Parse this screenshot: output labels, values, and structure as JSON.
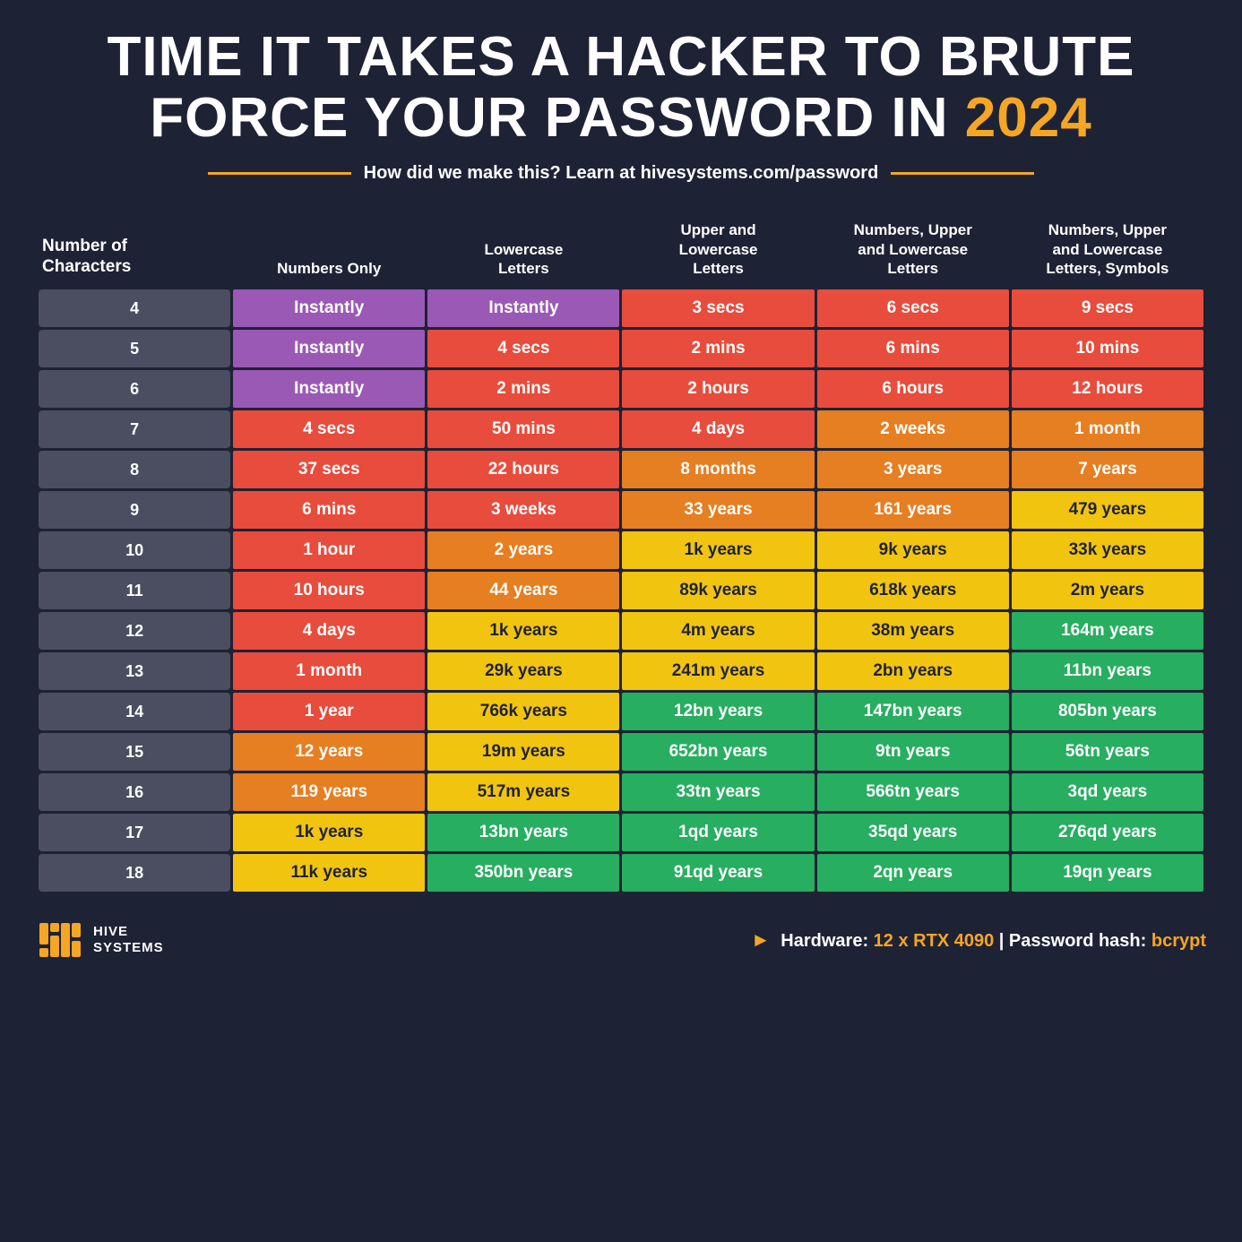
{
  "title": {
    "line1": "TIME IT TAKES A HACKER TO BRUTE",
    "line2": "FORCE YOUR PASSWORD IN",
    "year": "2024"
  },
  "subtitle": "How did we make this? Learn at hivesystems.com/password",
  "columns": [
    "Number of Characters",
    "Numbers Only",
    "Lowercase Letters",
    "Upper and Lowercase Letters",
    "Numbers, Upper and Lowercase Letters",
    "Numbers, Upper and Lowercase Letters, Symbols"
  ],
  "rows": [
    {
      "chars": "4",
      "values": [
        "Instantly",
        "Instantly",
        "3 secs",
        "6 secs",
        "9 secs"
      ],
      "colors": [
        "purple",
        "purple",
        "red",
        "red",
        "red"
      ]
    },
    {
      "chars": "5",
      "values": [
        "Instantly",
        "4 secs",
        "2 mins",
        "6 mins",
        "10 mins"
      ],
      "colors": [
        "purple",
        "red",
        "red",
        "red",
        "red"
      ]
    },
    {
      "chars": "6",
      "values": [
        "Instantly",
        "2 mins",
        "2 hours",
        "6 hours",
        "12 hours"
      ],
      "colors": [
        "purple",
        "red",
        "red",
        "red",
        "red"
      ]
    },
    {
      "chars": "7",
      "values": [
        "4 secs",
        "50 mins",
        "4 days",
        "2 weeks",
        "1 month"
      ],
      "colors": [
        "red",
        "red",
        "red",
        "orange",
        "orange"
      ]
    },
    {
      "chars": "8",
      "values": [
        "37 secs",
        "22 hours",
        "8 months",
        "3 years",
        "7 years"
      ],
      "colors": [
        "red",
        "red",
        "orange",
        "orange",
        "orange"
      ]
    },
    {
      "chars": "9",
      "values": [
        "6 mins",
        "3 weeks",
        "33 years",
        "161 years",
        "479 years"
      ],
      "colors": [
        "red",
        "red",
        "orange",
        "orange",
        "yellow"
      ]
    },
    {
      "chars": "10",
      "values": [
        "1 hour",
        "2 years",
        "1k years",
        "9k years",
        "33k years"
      ],
      "colors": [
        "red",
        "orange",
        "yellow",
        "yellow",
        "yellow"
      ]
    },
    {
      "chars": "11",
      "values": [
        "10 hours",
        "44 years",
        "89k years",
        "618k years",
        "2m years"
      ],
      "colors": [
        "red",
        "orange",
        "yellow",
        "yellow",
        "yellow"
      ]
    },
    {
      "chars": "12",
      "values": [
        "4 days",
        "1k years",
        "4m years",
        "38m years",
        "164m years"
      ],
      "colors": [
        "red",
        "yellow",
        "yellow",
        "yellow",
        "green"
      ]
    },
    {
      "chars": "13",
      "values": [
        "1 month",
        "29k years",
        "241m years",
        "2bn years",
        "11bn years"
      ],
      "colors": [
        "red",
        "yellow",
        "yellow",
        "yellow",
        "green"
      ]
    },
    {
      "chars": "14",
      "values": [
        "1 year",
        "766k years",
        "12bn years",
        "147bn years",
        "805bn years"
      ],
      "colors": [
        "red",
        "yellow",
        "green",
        "green",
        "green"
      ]
    },
    {
      "chars": "15",
      "values": [
        "12 years",
        "19m years",
        "652bn years",
        "9tn years",
        "56tn years"
      ],
      "colors": [
        "orange",
        "yellow",
        "green",
        "green",
        "green"
      ]
    },
    {
      "chars": "16",
      "values": [
        "119 years",
        "517m years",
        "33tn years",
        "566tn years",
        "3qd years"
      ],
      "colors": [
        "orange",
        "yellow",
        "green",
        "green",
        "green"
      ]
    },
    {
      "chars": "17",
      "values": [
        "1k years",
        "13bn years",
        "1qd years",
        "35qd years",
        "276qd years"
      ],
      "colors": [
        "yellow",
        "green",
        "green",
        "green",
        "green"
      ]
    },
    {
      "chars": "18",
      "values": [
        "11k years",
        "350bn years",
        "91qd years",
        "2qn years",
        "19qn years"
      ],
      "colors": [
        "yellow",
        "green",
        "green",
        "green",
        "green"
      ]
    }
  ],
  "footer": {
    "hardware_label": "Hardware:",
    "hardware_value": "12 x RTX 4090",
    "separator": "|",
    "hash_label": "Password hash:",
    "hash_value": "bcrypt",
    "logo_line1": "HIVE",
    "logo_line2": "SYSTEMS"
  }
}
